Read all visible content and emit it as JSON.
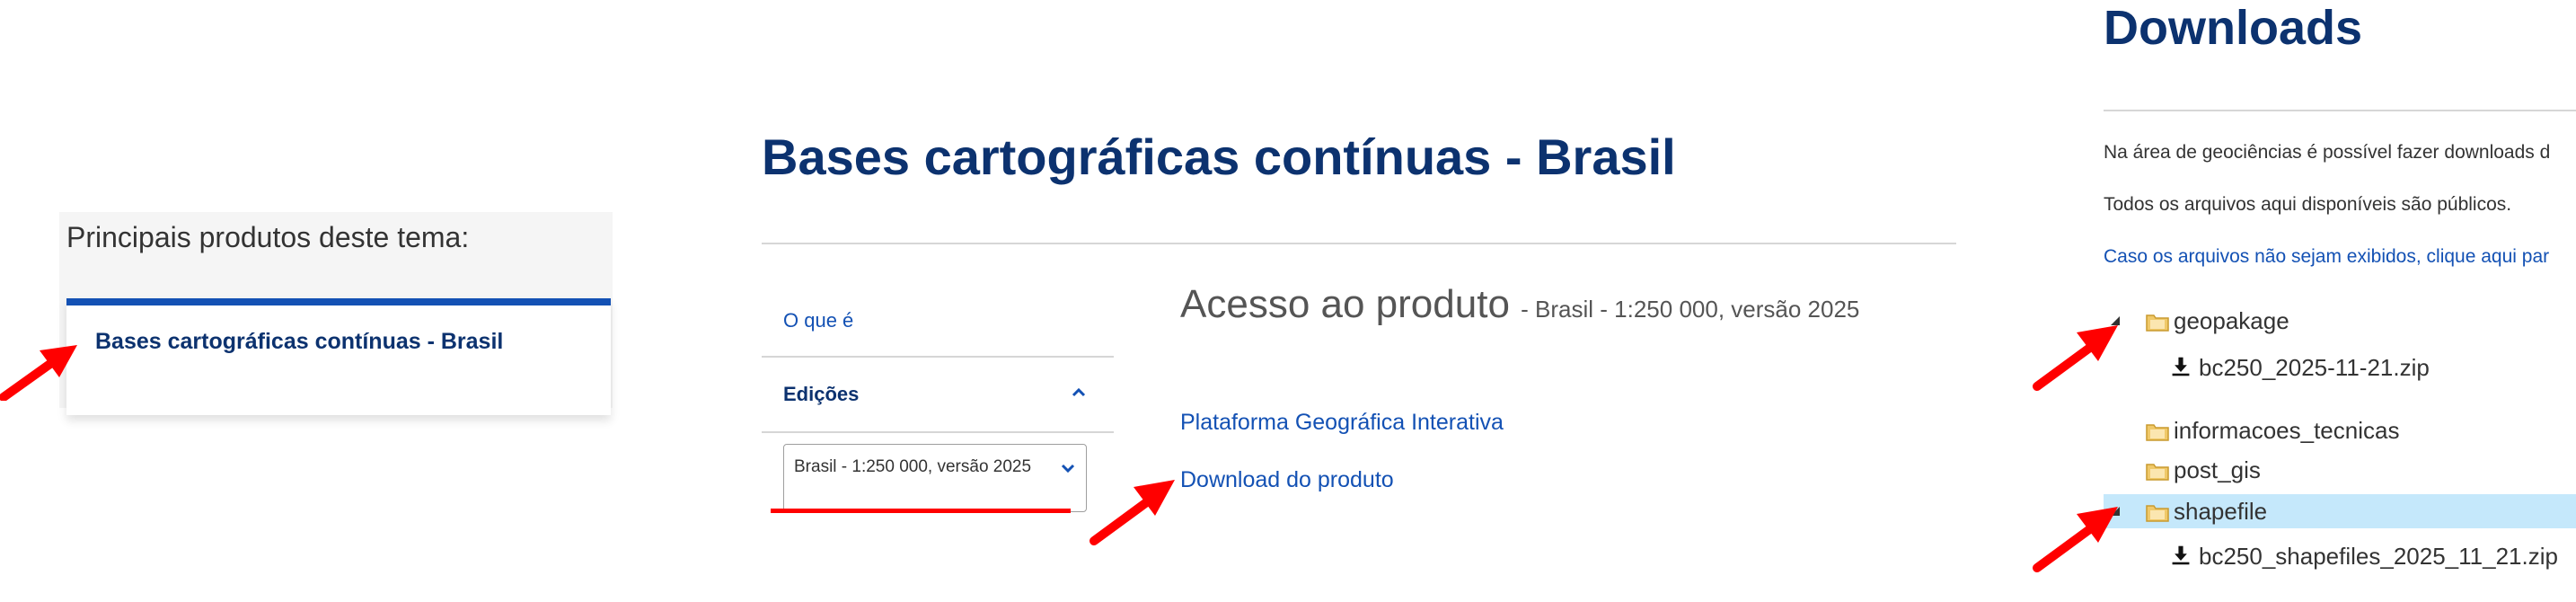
{
  "panel_left": {
    "heading": "Principais produtos deste tema:",
    "link": "Bases cartográficas contínuas - Brasil"
  },
  "panel_middle": {
    "title": "Bases cartográficas contínuas - Brasil",
    "nav": {
      "what_is": "O que é",
      "editions": "Edições",
      "selected_edition": "Brasil - 1:250 000, versão 2025"
    },
    "access": {
      "heading": "Acesso ao produto",
      "subheading": "- Brasil - 1:250 000, versão 2025",
      "link_platform": "Plataforma Geográfica Interativa",
      "link_download": "Download do produto"
    }
  },
  "panel_right": {
    "title": "Downloads",
    "text1": "Na área de geociências é possível fazer downloads d",
    "text2": "Todos os arquivos aqui disponíveis são públicos.",
    "text3": "Caso os arquivos não sejam exibidos, clique aqui par",
    "tree": [
      {
        "label": "geopakage",
        "type": "folder",
        "expanded": true
      },
      {
        "label": "bc250_2025-11-21.zip",
        "type": "file"
      },
      {
        "label": "informacoes_tecnicas",
        "type": "folder",
        "expanded": false
      },
      {
        "label": "post_gis",
        "type": "folder",
        "expanded": false
      },
      {
        "label": "shapefile",
        "type": "folder",
        "expanded": true,
        "selected": true
      },
      {
        "label": "bc250_shapefiles_2025_11_21.zip",
        "type": "file"
      }
    ]
  },
  "colors": {
    "heading_blue": "#0c326f",
    "link_blue": "#1351b4",
    "annotation_red": "#ff0000",
    "selection_bg": "#c5e8fb"
  }
}
